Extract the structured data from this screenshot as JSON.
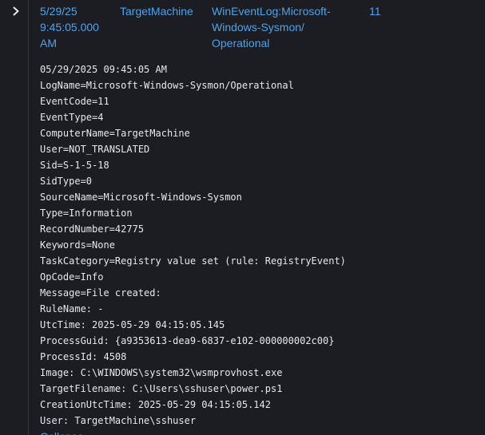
{
  "colors": {
    "background": "#1b1d22",
    "link": "#4fa3e8",
    "text": "#e6e8eb",
    "divider": "#343840"
  },
  "row": {
    "expander_icon": "chevron-right-icon",
    "time": "5/29/25\n9:45:05.000\nAM",
    "host": "TargetMachine",
    "source": "WinEventLog:Microsoft-\nWindows-Sysmon/\nOperational",
    "event_code": "11"
  },
  "event_lines": [
    "05/29/2025 09:45:05 AM",
    "LogName=Microsoft-Windows-Sysmon/Operational",
    "EventCode=11",
    "EventType=4",
    "ComputerName=TargetMachine",
    "User=NOT_TRANSLATED",
    "Sid=S-1-5-18",
    "SidType=0",
    "SourceName=Microsoft-Windows-Sysmon",
    "Type=Information",
    "RecordNumber=42775",
    "Keywords=None",
    "TaskCategory=Registry value set (rule: RegistryEvent)",
    "OpCode=Info",
    "Message=File created:",
    "RuleName: -",
    "UtcTime: 2025-05-29 04:15:05.145",
    "ProcessGuid: {a9353613-dea9-6837-e102-000000002c00}",
    "ProcessId: 4508",
    "Image: C:\\WINDOWS\\system32\\wsmprovhost.exe",
    "TargetFilename: C:\\Users\\sshuser\\power.ps1",
    "CreationUtcTime: 2025-05-29 04:15:05.142",
    "User: TargetMachine\\sshuser"
  ],
  "collapse_label": "Collapse"
}
